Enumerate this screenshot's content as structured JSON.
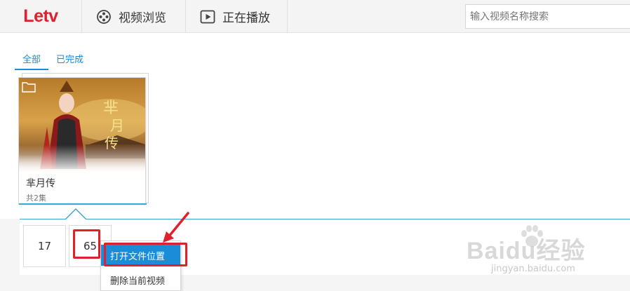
{
  "app": {
    "logo_text": "Letv",
    "brand_color": "#e0202a",
    "accent_color": "#1a8cd8"
  },
  "nav": {
    "browse_label": "视频浏览",
    "browse_icon": "film-reel-icon",
    "playing_label": "正在播放",
    "playing_icon": "play-icon"
  },
  "search": {
    "placeholder": "输入视频名称搜索",
    "value": ""
  },
  "tabs": [
    {
      "label": "全部",
      "active": true
    },
    {
      "label": "已完成",
      "active": false
    }
  ],
  "library": {
    "items": [
      {
        "title": "芈月传",
        "episodes_text": "共2集",
        "poster_icon": "folder-icon"
      }
    ]
  },
  "episodes": [
    {
      "label": "17"
    },
    {
      "label": "65"
    }
  ],
  "context_menu": {
    "items": [
      {
        "label": "打开文件位置",
        "highlighted": true
      },
      {
        "label": "删除当前视频",
        "highlighted": false
      }
    ]
  },
  "watermark": {
    "brand": "Baidu经验",
    "site": "jingyan.baidu.com"
  }
}
